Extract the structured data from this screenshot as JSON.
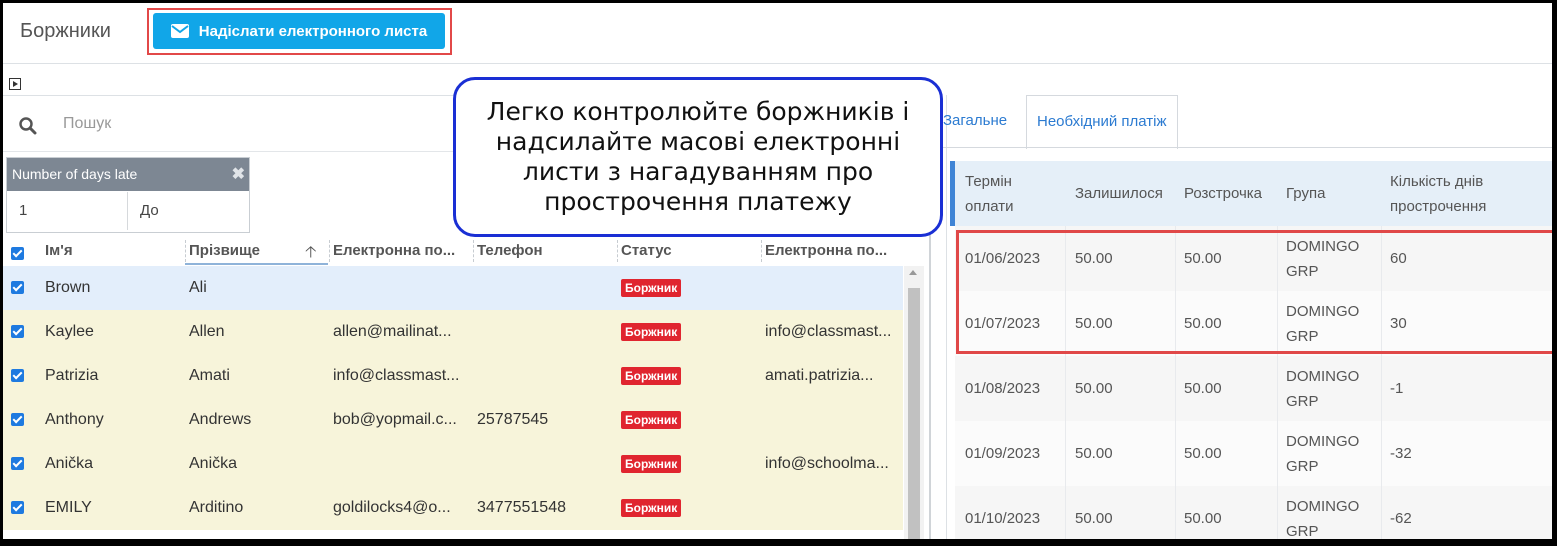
{
  "header": {
    "title": "Боржники",
    "email_button": "Надіслати електронного листа"
  },
  "search": {
    "placeholder": "Пошук"
  },
  "filter": {
    "title": "Number of days late",
    "from_value": "1",
    "to_placeholder": "До"
  },
  "grid": {
    "columns": [
      "Ім'я",
      "Прізвище",
      "Електронна по...",
      "Телефон",
      "Статус",
      "Електронна по..."
    ],
    "rows": [
      {
        "first": "Brown",
        "last": "Ali",
        "email": "",
        "phone": "",
        "status": "Боржник",
        "email2": "",
        "checked": true
      },
      {
        "first": "Kaylee",
        "last": "Allen",
        "email": "allen@mailinat...",
        "phone": "",
        "status": "Боржник",
        "email2": "info@classmast...",
        "checked": true
      },
      {
        "first": "Patrizia",
        "last": "Amati",
        "email": "info@classmast...",
        "phone": "",
        "status": "Боржник",
        "email2": "amati.patrizia...",
        "checked": true
      },
      {
        "first": "Anthony",
        "last": "Andrews",
        "email": "bob@yopmail.c...",
        "phone": "25787545",
        "status": "Боржник",
        "email2": "",
        "checked": true
      },
      {
        "first": "Anička",
        "last": "Anička",
        "email": "",
        "phone": "",
        "status": "Боржник",
        "email2": "info@schoolma...",
        "checked": true
      },
      {
        "first": "EMILY",
        "last": "Arditino",
        "email": "goldilocks4@o...",
        "phone": "3477551548",
        "status": "Боржник",
        "email2": "",
        "checked": true
      }
    ]
  },
  "tabs": {
    "general": "Загальне",
    "required": "Необхідний платіж"
  },
  "payments": {
    "columns": [
      "Термін оплати",
      "Залишилося",
      "Розстрочка",
      "Група",
      "Кількість днів прострочення"
    ],
    "rows": [
      {
        "due": "01/06/2023",
        "remaining": "50.00",
        "installment": "50.00",
        "group": "DOMINGO GRP",
        "days": "60"
      },
      {
        "due": "01/07/2023",
        "remaining": "50.00",
        "installment": "50.00",
        "group": "DOMINGO GRP",
        "days": "30"
      },
      {
        "due": "01/08/2023",
        "remaining": "50.00",
        "installment": "50.00",
        "group": "DOMINGO GRP",
        "days": "-1"
      },
      {
        "due": "01/09/2023",
        "remaining": "50.00",
        "installment": "50.00",
        "group": "DOMINGO GRP",
        "days": "-32"
      },
      {
        "due": "01/10/2023",
        "remaining": "50.00",
        "installment": "50.00",
        "group": "DOMINGO GRP",
        "days": "-62"
      }
    ]
  },
  "callout": {
    "text": "Легко контролюйте боржників і надсилайте масові електронні листи з нагадуванням про прострочення платежу"
  },
  "colors": {
    "accent": "#11a6e8",
    "badge": "#e0252f",
    "highlight": "#e04848",
    "callout_border": "#1a2fd4"
  }
}
